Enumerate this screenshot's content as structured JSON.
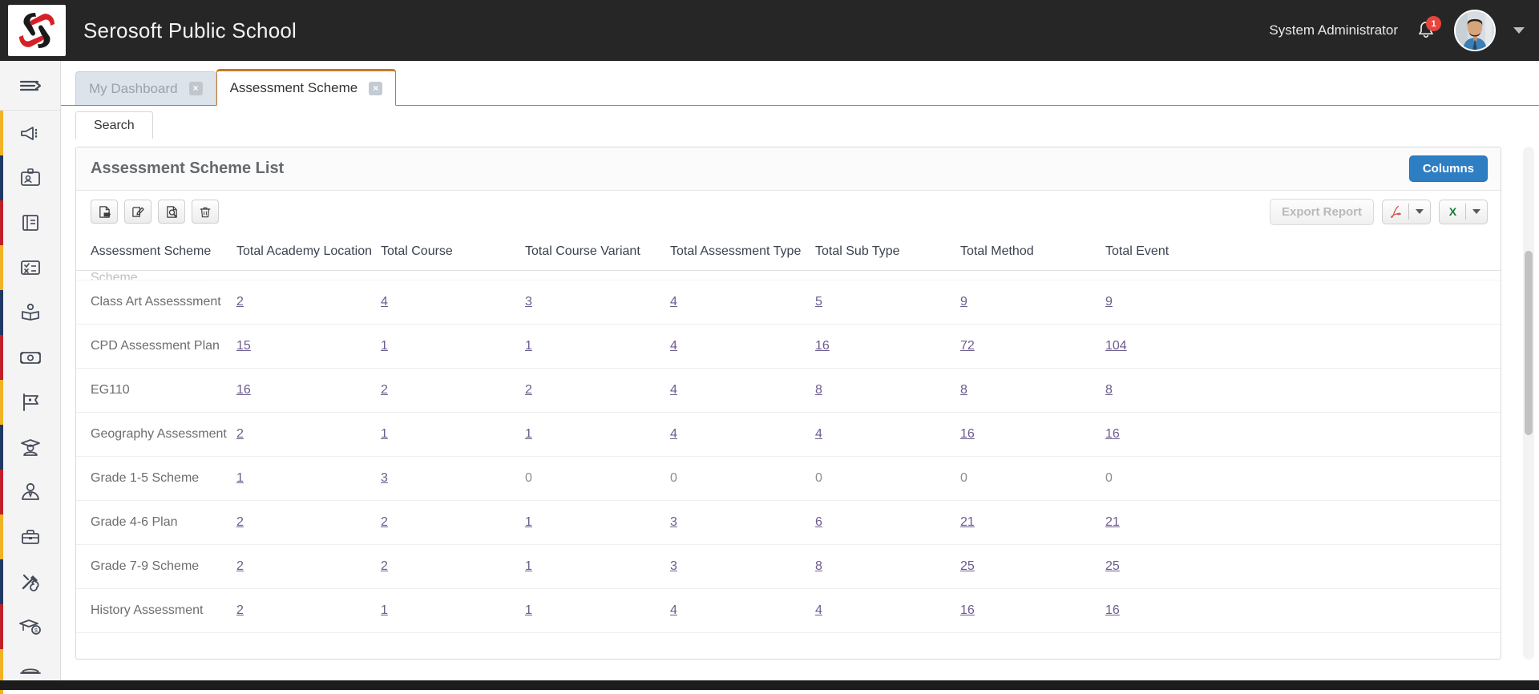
{
  "header": {
    "app_title": "Serosoft Public School",
    "user_name": "System Administrator",
    "notification_count": "1",
    "logo_name": "serosoft-logo"
  },
  "sidebar": {
    "toggle_label": "expand-menu",
    "items": [
      {
        "icon": "megaphone-icon",
        "accent": "#f0b323"
      },
      {
        "icon": "id-card-icon",
        "accent": "#1f3864"
      },
      {
        "icon": "book-icon",
        "accent": "#c0202a"
      },
      {
        "icon": "checklist-icon",
        "accent": "#f0b323"
      },
      {
        "icon": "open-book-person-icon",
        "accent": "#1f3864"
      },
      {
        "icon": "banknote-icon",
        "accent": "#c0202a"
      },
      {
        "icon": "flag-icon",
        "accent": "#f0b323"
      },
      {
        "icon": "graduate-icon",
        "accent": "#1f3864"
      },
      {
        "icon": "staff-person-icon",
        "accent": "#c0202a"
      },
      {
        "icon": "briefcase-icon",
        "accent": "#f0b323"
      },
      {
        "icon": "tools-icon",
        "accent": "#1f3864"
      },
      {
        "icon": "scholarship-icon",
        "accent": "#c0202a"
      },
      {
        "icon": "bench-icon",
        "accent": "#f0b323"
      }
    ]
  },
  "tabs": [
    {
      "label": "My Dashboard",
      "active": false
    },
    {
      "label": "Assessment Scheme",
      "active": true
    }
  ],
  "subtabs": [
    {
      "label": "Search",
      "active": true
    }
  ],
  "card": {
    "title": "Assessment Scheme List",
    "columns_button": "Columns",
    "toolbar": {
      "add_icon": "add-document-icon",
      "edit_icon": "edit-icon",
      "view_icon": "search-document-icon",
      "delete_icon": "trash-icon",
      "export_report_label": "Export Report",
      "pdf_icon": "pdf-icon",
      "excel_icon": "excel-icon",
      "dropdown_icon": "chevron-down-icon"
    }
  },
  "table": {
    "headers": [
      "Assessment Scheme",
      "Total Academy Location",
      "Total Course",
      "Total Course Variant",
      "Total Assessment Type",
      "Total Sub Type",
      "Total Method",
      "Total Event"
    ],
    "clipped_row_text": "Scheme",
    "rows": [
      {
        "name": "Class Art Assesssment",
        "values": [
          "2",
          "4",
          "3",
          "4",
          "5",
          "9",
          "9"
        ],
        "linked": [
          true,
          true,
          true,
          true,
          true,
          true,
          true
        ]
      },
      {
        "name": "CPD Assessment Plan",
        "values": [
          "15",
          "1",
          "1",
          "4",
          "16",
          "72",
          "104"
        ],
        "linked": [
          true,
          true,
          true,
          true,
          true,
          true,
          true
        ]
      },
      {
        "name": "EG110",
        "values": [
          "16",
          "2",
          "2",
          "4",
          "8",
          "8",
          "8"
        ],
        "linked": [
          true,
          true,
          true,
          true,
          true,
          true,
          true
        ]
      },
      {
        "name": "Geography Assessment",
        "values": [
          "2",
          "1",
          "1",
          "4",
          "4",
          "16",
          "16"
        ],
        "linked": [
          true,
          true,
          true,
          true,
          true,
          true,
          true
        ]
      },
      {
        "name": "Grade 1-5 Scheme",
        "values": [
          "1",
          "3",
          "0",
          "0",
          "0",
          "0",
          "0"
        ],
        "linked": [
          true,
          true,
          false,
          false,
          false,
          false,
          false
        ]
      },
      {
        "name": "Grade 4-6 Plan",
        "values": [
          "2",
          "2",
          "1",
          "3",
          "6",
          "21",
          "21"
        ],
        "linked": [
          true,
          true,
          true,
          true,
          true,
          true,
          true
        ]
      },
      {
        "name": "Grade 7-9 Scheme",
        "values": [
          "2",
          "2",
          "1",
          "3",
          "8",
          "25",
          "25"
        ],
        "linked": [
          true,
          true,
          true,
          true,
          true,
          true,
          true
        ]
      },
      {
        "name": "History Assessment",
        "values": [
          "2",
          "1",
          "1",
          "4",
          "4",
          "16",
          "16"
        ],
        "linked": [
          true,
          true,
          true,
          true,
          true,
          true,
          true
        ]
      }
    ]
  },
  "colors": {
    "topbar_bg": "#262626",
    "accent_orange": "#c47a28",
    "link_purple": "#6b5b8e",
    "button_blue": "#2e7ec4",
    "badge_red": "#e8453c"
  }
}
